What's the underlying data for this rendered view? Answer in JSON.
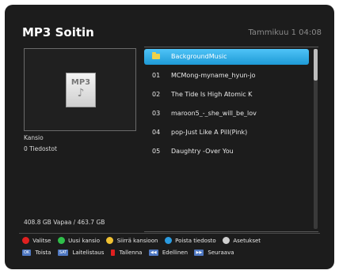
{
  "app": {
    "title": "MP3 Soitin",
    "time": "Tammikuu 1 04:08"
  },
  "preview": {
    "icon_label": "MP3",
    "icon": "music-file-icon"
  },
  "info": {
    "kansio_label": "Kansio",
    "files_count": "0 Tiedostot",
    "storage": "408.8 GB Vapaa / 463.7 GB"
  },
  "list": {
    "items": [
      {
        "index": "",
        "name": "BackgroundMusic",
        "type": "folder"
      },
      {
        "index": "01",
        "name": "MCMong-myname_hyun-jo"
      },
      {
        "index": "02",
        "name": "The Tide Is High   Atomic K"
      },
      {
        "index": "03",
        "name": "maroon5_-_she_will_be_lov"
      },
      {
        "index": "04",
        "name": "pop-Just Like A Pill(Pink)"
      },
      {
        "index": "05",
        "name": "Daughtry -Over You"
      }
    ]
  },
  "legend": {
    "row1": [
      {
        "color": "#e02020",
        "label": "Valitse"
      },
      {
        "color": "#2fbf4a",
        "label": "Uusi kansio"
      },
      {
        "color": "#f1c232",
        "label": "Siirrä kansioon"
      },
      {
        "color": "#2a9be0",
        "label": "Poista tiedosto"
      },
      {
        "icon": "menu-key-icon",
        "label": "Asetukset"
      }
    ],
    "row2": [
      {
        "key": "OK",
        "label": "Toista"
      },
      {
        "key": "SAT",
        "label": "Laitelistaus"
      },
      {
        "key_color": "#e02020",
        "label": "Tallenna"
      },
      {
        "key": "◀◀",
        "label": "Edellinen"
      },
      {
        "key": "▶▶",
        "label": "Seuraava"
      }
    ]
  }
}
